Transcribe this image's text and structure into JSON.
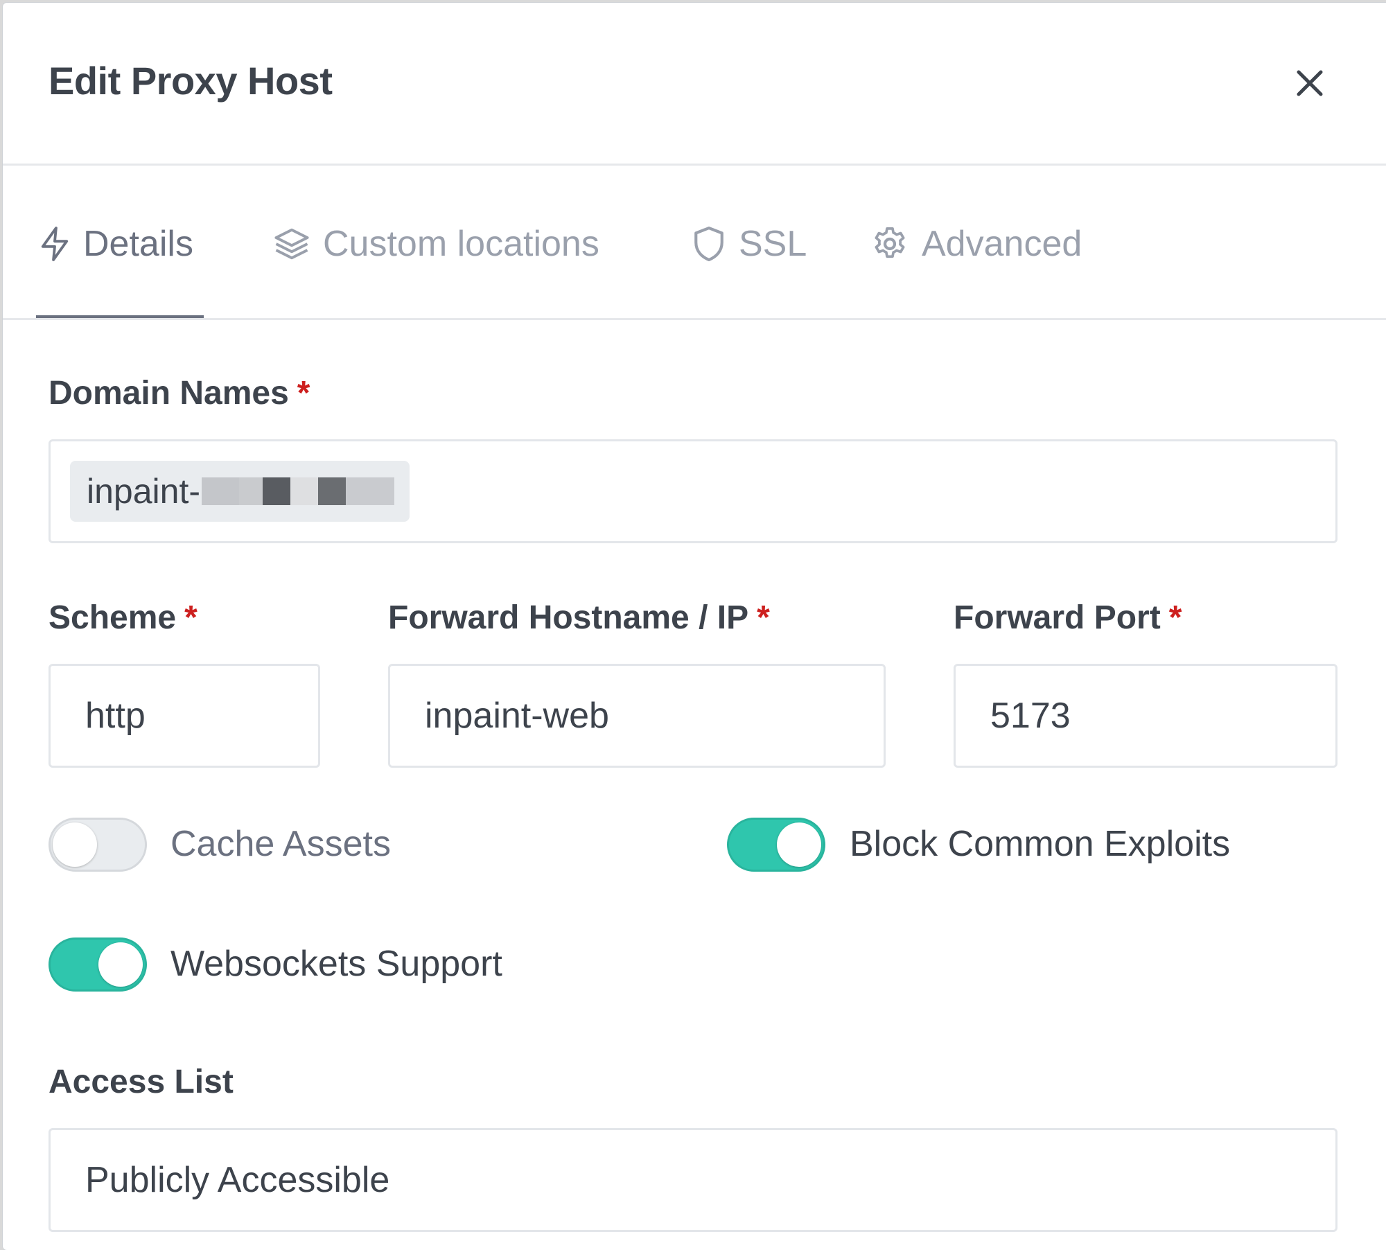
{
  "modal": {
    "title": "Edit Proxy Host",
    "close_icon": "close-icon"
  },
  "tabs": [
    {
      "label": "Details",
      "icon": "lightning-icon",
      "active": true
    },
    {
      "label": "Custom locations",
      "icon": "layers-icon",
      "active": false
    },
    {
      "label": "SSL",
      "icon": "shield-icon",
      "active": false
    },
    {
      "label": "Advanced",
      "icon": "gear-icon",
      "active": false
    }
  ],
  "form": {
    "domain_names": {
      "label": "Domain Names",
      "required_mark": "*",
      "chips": [
        "inpaint-"
      ]
    },
    "scheme": {
      "label": "Scheme",
      "required_mark": "*",
      "value": "http"
    },
    "forward_host": {
      "label": "Forward Hostname / IP",
      "required_mark": "*",
      "value": "inpaint-web"
    },
    "forward_port": {
      "label": "Forward Port",
      "required_mark": "*",
      "value": "5173"
    },
    "toggles": {
      "cache_assets": {
        "label": "Cache Assets",
        "on": false
      },
      "block_exploits": {
        "label": "Block Common Exploits",
        "on": true
      },
      "websockets": {
        "label": "Websockets Support",
        "on": true
      }
    },
    "access_list": {
      "label": "Access List",
      "value": "Publicly Accessible"
    }
  },
  "colors": {
    "toggle_on": "#2fc6ad",
    "required": "#cd201f",
    "text": "#3d434c",
    "muted": "#9aa0ac"
  }
}
